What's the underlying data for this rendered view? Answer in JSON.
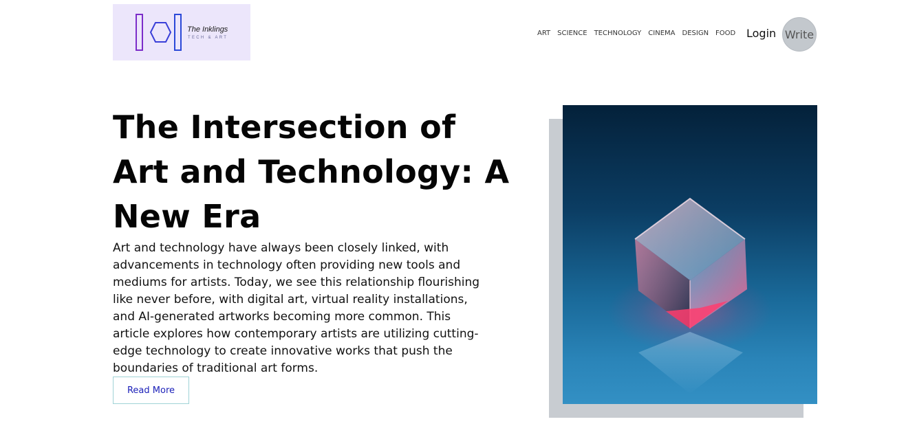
{
  "brand": {
    "name": "The Inklings",
    "tagline": "TECH & ART"
  },
  "nav": {
    "items": [
      "ART",
      "SCIENCE",
      "TECHNOLOGY",
      "CINEMA",
      "DESIGN",
      "FOOD"
    ],
    "login_label": "Login",
    "write_label": "Write"
  },
  "article": {
    "title": "The Intersection of Art and Technology: A New Era",
    "excerpt": "Art and technology have always been closely linked, with advancements in technology often providing new tools and mediums for artists. Today, we see this relationship flourishing like never before, with digital art, virtual reality installations, and AI-generated artworks becoming more common. This article explores how contemporary artists are utilizing cutting-edge technology to create innovative works that push the boundaries of traditional art forms.",
    "read_more_label": "Read More"
  },
  "colors": {
    "logo_bg": "#ece6fb",
    "accent_link": "#1a1fb8",
    "write_button_bg": "#c3c8cd",
    "image_shadow": "#c8ccd1"
  },
  "icons": {
    "logo": "hexagon-between-bars-logo",
    "hero_image": "glowing-glass-cube"
  }
}
